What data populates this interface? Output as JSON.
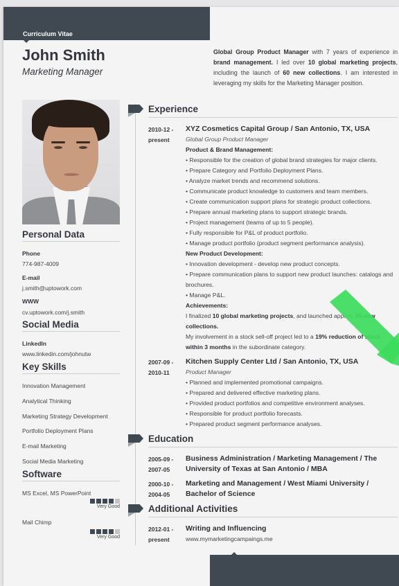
{
  "header": {
    "label": "Curriculum Vitae",
    "name": "John Smith",
    "title": "Marketing Manager"
  },
  "summary": {
    "parts": [
      {
        "text": "Global Group Product Manager",
        "bold": true
      },
      {
        "text": " with 7 years of experience in ",
        "bold": false
      },
      {
        "text": "brand management.",
        "bold": true
      },
      {
        "text": " I led over ",
        "bold": false
      },
      {
        "text": "10 global marketing projects",
        "bold": true
      },
      {
        "text": ", including the launch of ",
        "bold": false
      },
      {
        "text": "60 new collections",
        "bold": true
      },
      {
        "text": ". I am interested in leveraging my skills for the Marketing Manager position.",
        "bold": false
      }
    ]
  },
  "photo": {
    "alt": "Portrait of John Smith"
  },
  "personal": {
    "heading": "Personal Data",
    "phone_label": "Phone",
    "phone": "774-987-4009",
    "email_label": "E-mail",
    "email": "j.smith@uptowork.com",
    "www_label": "WWW",
    "www": "cv.uptowork.com/j.smith"
  },
  "social": {
    "heading": "Social Media",
    "linkedin_label": "LinkedIn",
    "linkedin": "www.linkedin.com/johnutw"
  },
  "skills": {
    "heading": "Key Skills",
    "items": [
      "Innovation Management",
      "Analytical Thinking",
      "Marketing Strategy Development",
      "Portfolio Deployment Plans",
      "E-mail Marketing",
      "Social Media Marketing"
    ]
  },
  "software": {
    "heading": "Software",
    "items": [
      {
        "name": "MS Excel, MS PowerPoint",
        "rating": 4,
        "max": 5,
        "label": "Very Good"
      },
      {
        "name": "Mail Chimp",
        "rating": 4,
        "max": 5,
        "label": "Very Good"
      }
    ]
  },
  "experience": {
    "heading": "Experience",
    "jobs": [
      {
        "date_start": "2010-12 -",
        "date_end": "present",
        "org": "XYZ Cosmetics Capital Group / San Antonio, TX, USA",
        "role": "Global Group Product Manager",
        "sections": [
          {
            "title": "Product & Brand Management:",
            "bullets": [
              "Responsible for the creation of global brand strategies for major clients.",
              "Prepare Category and Portfolio Deployment Plans.",
              "Analyze market trends and recommend solutions.",
              "Communicate product knowledge to customers and team members.",
              "Create communication support plans for strategic product collections.",
              "Prepare annual marketing plans to support strategic brands.",
              "Project management (teams of up to 5 people).",
              "Fully responsible for P&L of product portfolio.",
              "Manage product portfolio (product segment performance analysis)."
            ]
          },
          {
            "title": "New Product Development:",
            "bullets": [
              "Innovation development - develop new product concepts.",
              "Prepare communication plans to support new product launches: catalogs and brochures.",
              "Manage P&L."
            ]
          }
        ],
        "achievements_title": "Achievements:",
        "achievements": [
          [
            {
              "text": "I finalized ",
              "bold": false
            },
            {
              "text": "10 global marketing projects",
              "bold": true
            },
            {
              "text": ", and launched approx. ",
              "bold": false
            },
            {
              "text": "90 new collections.",
              "bold": true
            }
          ],
          [
            {
              "text": "My involvement in a stock sell-off project led to a ",
              "bold": false
            },
            {
              "text": "19% reduction of stock within 3 months",
              "bold": true
            },
            {
              "text": " in the subordinate category.",
              "bold": false
            }
          ]
        ]
      },
      {
        "date_start": "2007-09 -",
        "date_end": "2010-11",
        "org": "Kitchen Supply Center Ltd / San Antonio, TX, USA",
        "role": "Product Manager",
        "bullets": [
          "Planned and implemented promotional campaigns.",
          "Prepared and delivered effective marketing plans.",
          "Provided product portfolios and competitive environment analyses.",
          "Responsible for product portfolio forecasts.",
          "Prepared product segment performance analyses."
        ]
      }
    ]
  },
  "education": {
    "heading": "Education",
    "items": [
      {
        "date_start": "2005-09 -",
        "date_end": "2007-05",
        "text": "Business Administration / Marketing Management / The University of Texas at San Antonio / MBA"
      },
      {
        "date_start": "2000-10 -",
        "date_end": "2004-05",
        "text": "Marketing and Management / West Miami University / Bachelor of Science"
      }
    ]
  },
  "activities": {
    "heading": "Additional Activities",
    "items": [
      {
        "date_start": "2012-01 -",
        "date_end": "present",
        "title": "Writing and Influencing",
        "url": "www.mymarketingcampaings.me"
      }
    ]
  },
  "colors": {
    "dark": "#404852",
    "accent_check": "#3ddc5c",
    "text": "#33373d"
  }
}
